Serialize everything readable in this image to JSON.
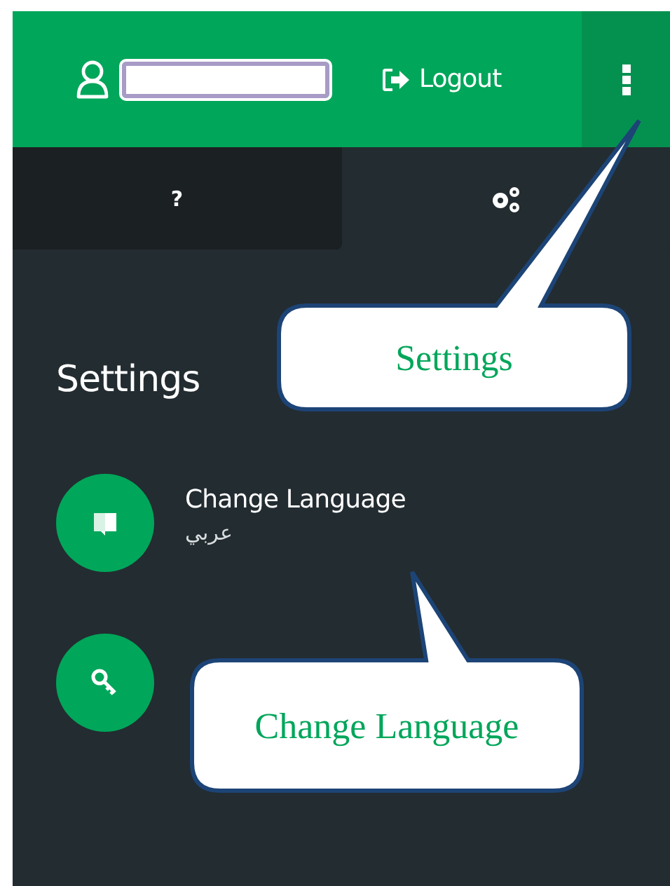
{
  "header": {
    "logout": {
      "label": "Logout"
    }
  },
  "tabs": [
    {
      "kind": "help",
      "label": "?",
      "selected": false
    },
    {
      "kind": "gears",
      "selected": true
    }
  ],
  "panel": {
    "title": "Settings",
    "items": [
      {
        "kind": "language",
        "title": "Change Language",
        "subtitle": "عربي"
      },
      {
        "kind": "key"
      }
    ]
  },
  "callouts": [
    {
      "text": "Settings"
    },
    {
      "text": "Change Language"
    }
  ]
}
